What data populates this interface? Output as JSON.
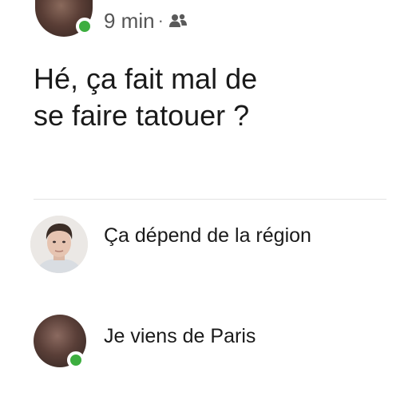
{
  "post": {
    "time": "9 min",
    "separator": "·",
    "audience_icon": "group-icon",
    "author_online": true,
    "text_line1": "Hé, ça fait mal de",
    "text_line2": "se faire tatouer ?"
  },
  "replies": [
    {
      "text": "Ça dépend de la région",
      "avatar": "avatar-photo",
      "online": false
    },
    {
      "text": "Je viens de Paris",
      "avatar": "avatar-photo",
      "online": true
    }
  ],
  "colors": {
    "online": "#3dae3f",
    "text": "#1a1a1a",
    "meta": "#555555",
    "divider": "#e2e2e2"
  }
}
